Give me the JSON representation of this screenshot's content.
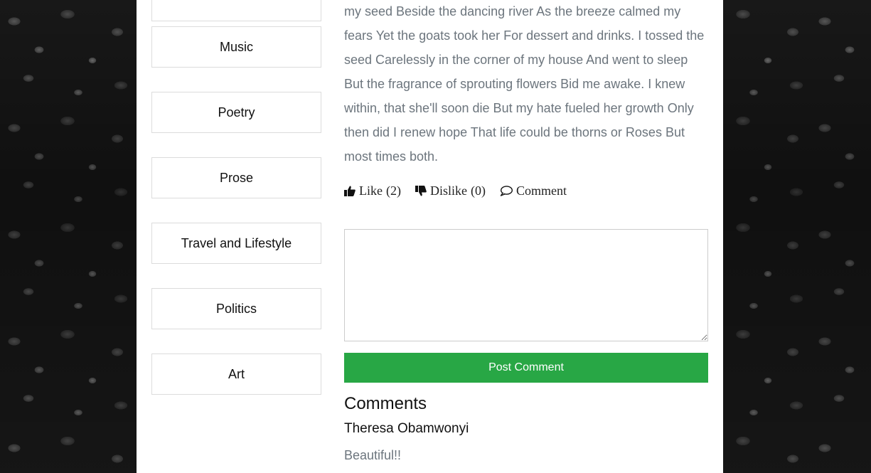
{
  "categories": [
    {
      "label": "Music"
    },
    {
      "label": "Poetry"
    },
    {
      "label": "Prose"
    },
    {
      "label": "Travel and Lifestyle"
    },
    {
      "label": "Politics"
    },
    {
      "label": "Art"
    }
  ],
  "article": {
    "body": "my seed Beside the dancing river As the breeze calmed my fears Yet the goats took her For dessert and drinks. I tossed the seed Carelessly in the corner of my house And went to sleep But the fragrance of sprouting flowers Bid me awake. I knew within, that she'll soon die But my hate fueled her growth Only then did I renew hope That life could be thorns or Roses But most times both."
  },
  "actions": {
    "like_label": "Like",
    "like_count": "(2)",
    "dislike_label": "Dislike",
    "dislike_count": "(0)",
    "comment_label": "Comment",
    "like_icon": "thumbs-up-icon",
    "dislike_icon": "thumbs-down-icon",
    "comment_icon": "speech-bubble-icon"
  },
  "comment_form": {
    "value": "",
    "placeholder": "",
    "submit_label": "Post Comment",
    "submit_color": "#28a745"
  },
  "comments": {
    "title": "Comments",
    "items": [
      {
        "author": "Theresa Obamwonyi",
        "text": "Beautiful!!"
      }
    ]
  }
}
